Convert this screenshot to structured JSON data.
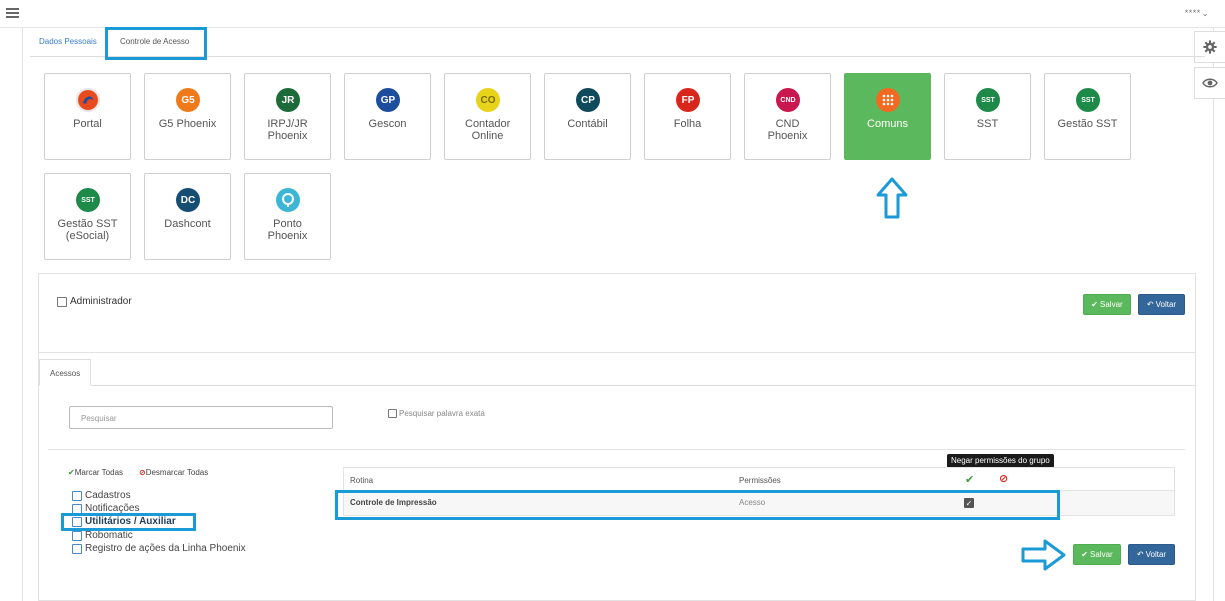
{
  "header": {
    "menu_icon": "hamburger-icon",
    "user_label": "****"
  },
  "side_actions": [
    {
      "icon": "gear-icon"
    },
    {
      "icon": "eye-icon"
    }
  ],
  "top_tabs": [
    {
      "label": "Dados Pessoais"
    },
    {
      "label": "Controle de Acesso",
      "active": true
    }
  ],
  "modules": [
    {
      "label": "Portal",
      "logo_text": "",
      "color": "#e8491d"
    },
    {
      "label": "G5 Phoenix",
      "logo_text": "G5",
      "color": "#f07a1a"
    },
    {
      "label": "IRPJ/JR Phoenix",
      "logo_text": "JR",
      "color": "#1e6b3a"
    },
    {
      "label": "Gescon",
      "logo_text": "GP",
      "color": "#1d4e9e"
    },
    {
      "label": "Contador Online",
      "logo_text": "CO",
      "color": "#e8d21a"
    },
    {
      "label": "Contábil",
      "logo_text": "CP",
      "color": "#0f4a5c"
    },
    {
      "label": "Folha",
      "logo_text": "FP",
      "color": "#d9261c"
    },
    {
      "label": "CND Phoenix",
      "logo_text": "CND",
      "color": "#c9174f"
    },
    {
      "label": "Comuns",
      "logo_text": "",
      "color": "#f26a21",
      "active": true
    },
    {
      "label": "SST",
      "logo_text": "SST",
      "color": "#1e8a4a"
    },
    {
      "label": "Gestão SST",
      "logo_text": "SST",
      "color": "#1e8a4a"
    },
    {
      "label": "Gestão SST (eSocial)",
      "logo_text": "SST",
      "color": "#1e8a4a"
    },
    {
      "label": "Dashcont",
      "logo_text": "DC",
      "color": "#164d73"
    },
    {
      "label": "Ponto Phoenix",
      "logo_text": "",
      "color": "#3cb6d6"
    }
  ],
  "admin": {
    "label": "Administrador",
    "checked": false
  },
  "buttons": {
    "save": "Salvar",
    "back": "Voltar"
  },
  "access_tab": {
    "label": "Acessos"
  },
  "search": {
    "placeholder": "Pesquisar",
    "exact_label": "Pesquisar palavra exata"
  },
  "bulk": {
    "mark_all": "Marcar Todas",
    "unmark_all": "Desmarcar Todas"
  },
  "tree": [
    {
      "label": "Cadastros"
    },
    {
      "label": "Notificações"
    },
    {
      "label": "Utilitários / Auxiliar",
      "selected": true
    },
    {
      "label": "Robomatic"
    },
    {
      "label": "Registro de ações da Linha Phoenix"
    }
  ],
  "tooltip": "Negar permissões do grupo",
  "table": {
    "headers": {
      "routine": "Rotina",
      "permissions": "Permissões"
    },
    "rows": [
      {
        "routine": "Controle de Impressão",
        "permission": "Acesso",
        "granted": true
      }
    ]
  },
  "colors": {
    "highlight": "#1a9ad6",
    "success": "#5cb85c",
    "primary": "#33669a",
    "danger": "#d9261c"
  }
}
